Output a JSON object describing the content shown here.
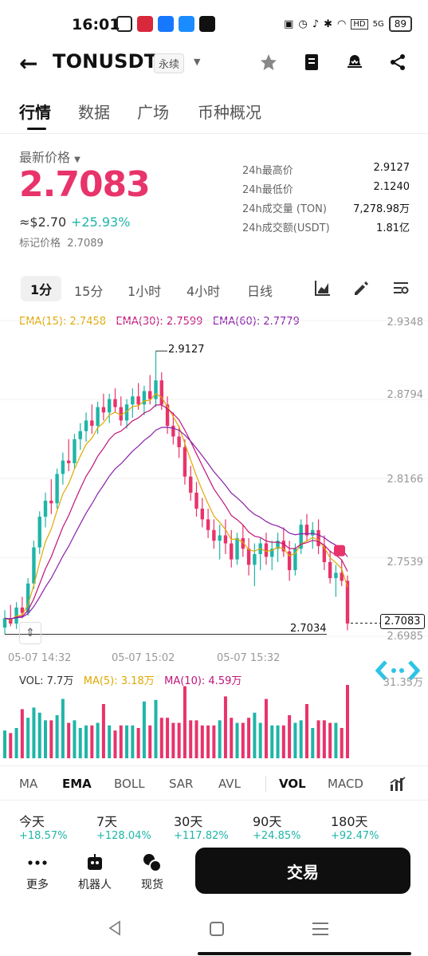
{
  "status_bar": {
    "time": "16:01",
    "network": "HD",
    "signal": "5G",
    "battery": "89"
  },
  "header": {
    "pair": "TONUSDT",
    "contract_type": "永续"
  },
  "tabs": [
    {
      "label": "行情",
      "active": true
    },
    {
      "label": "数据",
      "active": false
    },
    {
      "label": "广场",
      "active": false
    },
    {
      "label": "币种概况",
      "active": false
    }
  ],
  "price": {
    "label": "最新价格",
    "last": "2.7083",
    "usd_approx": "≈$2.70",
    "change_pct": "+25.93%",
    "mark_label": "标记价格",
    "mark_value": "2.7089"
  },
  "stats": [
    {
      "key": "24h最高价",
      "value": "2.9127"
    },
    {
      "key": "24h最低价",
      "value": "2.1240"
    },
    {
      "key": "24h成交量 (TON)",
      "value": "7,278.98万"
    },
    {
      "key": "24h成交额(USDT)",
      "value": "1.81亿"
    }
  ],
  "intervals": [
    {
      "label": "1分",
      "active": true
    },
    {
      "label": "15分",
      "active": false
    },
    {
      "label": "1小时",
      "active": false
    },
    {
      "label": "4小时",
      "active": false
    },
    {
      "label": "日线",
      "active": false
    }
  ],
  "ema": {
    "ema15": "EMA(15): 2.7458",
    "ema30": "EMA(30): 2.7599",
    "ema60": "EMA(60): 2.7779"
  },
  "chart_data": {
    "type": "candlestick",
    "y_ticks": [
      "2.9348",
      "2.8794",
      "2.8166",
      "2.7539",
      "2.6985"
    ],
    "x_ticks": [
      "05-07 14:32",
      "05-07 15:02",
      "05-07 15:32"
    ],
    "high_label": "2.9127",
    "low_label": "2.7034",
    "current_price": "2.7083",
    "ylim": [
      2.6985,
      2.9348
    ],
    "candles": [
      [
        2.705,
        2.718,
        2.7,
        2.712
      ],
      [
        2.712,
        2.722,
        2.706,
        2.708
      ],
      [
        2.708,
        2.724,
        2.704,
        2.72
      ],
      [
        2.72,
        2.728,
        2.712,
        2.716
      ],
      [
        2.716,
        2.742,
        2.714,
        2.738
      ],
      [
        2.738,
        2.77,
        2.734,
        2.765
      ],
      [
        2.765,
        2.792,
        2.76,
        2.788
      ],
      [
        2.788,
        2.806,
        2.78,
        2.8
      ],
      [
        2.8,
        2.816,
        2.79,
        2.798
      ],
      [
        2.798,
        2.824,
        2.794,
        2.82
      ],
      [
        2.82,
        2.836,
        2.812,
        2.83
      ],
      [
        2.83,
        2.846,
        2.822,
        2.828
      ],
      [
        2.828,
        2.85,
        2.824,
        2.846
      ],
      [
        2.846,
        2.858,
        2.838,
        2.852
      ],
      [
        2.852,
        2.866,
        2.844,
        2.86
      ],
      [
        2.86,
        2.872,
        2.85,
        2.856
      ],
      [
        2.856,
        2.874,
        2.85,
        2.87
      ],
      [
        2.87,
        2.88,
        2.86,
        2.866
      ],
      [
        2.866,
        2.88,
        2.858,
        2.876
      ],
      [
        2.876,
        2.884,
        2.866,
        2.87
      ],
      [
        2.87,
        2.878,
        2.856,
        2.86
      ],
      [
        2.86,
        2.876,
        2.854,
        2.872
      ],
      [
        2.872,
        2.884,
        2.862,
        2.878
      ],
      [
        2.878,
        2.888,
        2.868,
        2.872
      ],
      [
        2.872,
        2.886,
        2.864,
        2.882
      ],
      [
        2.882,
        2.894,
        2.872,
        2.876
      ],
      [
        2.876,
        2.912,
        2.87,
        2.89
      ],
      [
        2.89,
        2.896,
        2.868,
        2.872
      ],
      [
        2.872,
        2.878,
        2.85,
        2.856
      ],
      [
        2.856,
        2.866,
        2.842,
        2.848
      ],
      [
        2.848,
        2.856,
        2.832,
        2.84
      ],
      [
        2.84,
        2.846,
        2.812,
        2.818
      ],
      [
        2.818,
        2.826,
        2.8,
        2.806
      ],
      [
        2.806,
        2.814,
        2.788,
        2.794
      ],
      [
        2.794,
        2.802,
        2.78,
        2.786
      ],
      [
        2.786,
        2.794,
        2.772,
        2.778
      ],
      [
        2.778,
        2.786,
        2.764,
        2.77
      ],
      [
        2.77,
        2.782,
        2.756,
        2.774
      ],
      [
        2.774,
        2.786,
        2.76,
        2.768
      ],
      [
        2.768,
        2.778,
        2.75,
        2.756
      ],
      [
        2.756,
        2.776,
        2.752,
        2.772
      ],
      [
        2.772,
        2.782,
        2.758,
        2.764
      ],
      [
        2.764,
        2.772,
        2.744,
        2.752
      ],
      [
        2.752,
        2.768,
        2.736,
        2.76
      ],
      [
        2.76,
        2.772,
        2.748,
        2.768
      ],
      [
        2.768,
        2.776,
        2.752,
        2.758
      ],
      [
        2.758,
        2.77,
        2.748,
        2.764
      ],
      [
        2.764,
        2.776,
        2.754,
        2.77
      ],
      [
        2.77,
        2.78,
        2.758,
        2.762
      ],
      [
        2.762,
        2.77,
        2.74,
        2.748
      ],
      [
        2.748,
        2.768,
        2.744,
        2.764
      ],
      [
        2.764,
        2.786,
        2.76,
        2.782
      ],
      [
        2.782,
        2.79,
        2.77,
        2.774
      ],
      [
        2.774,
        2.784,
        2.764,
        2.778
      ],
      [
        2.778,
        2.786,
        2.76,
        2.766
      ],
      [
        2.766,
        2.774,
        2.748,
        2.754
      ],
      [
        2.754,
        2.762,
        2.738,
        2.742
      ],
      [
        2.742,
        2.752,
        2.728,
        2.746
      ],
      [
        2.746,
        2.756,
        2.736,
        2.74
      ],
      [
        2.74,
        2.744,
        2.703,
        2.708
      ]
    ]
  },
  "volume": {
    "vol": "VOL: 7.7万",
    "ma5": "MA(5): 3.18万",
    "ma10": "MA(10): 4.59万",
    "axis_max": "31.35万"
  },
  "indicators": [
    {
      "label": "MA",
      "active": false
    },
    {
      "label": "EMA",
      "active": true
    },
    {
      "label": "BOLL",
      "active": false
    },
    {
      "label": "SAR",
      "active": false
    },
    {
      "label": "AVL",
      "active": false
    },
    {
      "label": "VOL",
      "active": true
    },
    {
      "label": "MACD",
      "active": false
    }
  ],
  "returns": [
    {
      "label": "今天",
      "value": "+18.57%"
    },
    {
      "label": "7天",
      "value": "+128.04%"
    },
    {
      "label": "30天",
      "value": "+117.82%"
    },
    {
      "label": "90天",
      "value": "+24.85%"
    },
    {
      "label": "180天",
      "value": "+92.47%"
    }
  ],
  "bottom": {
    "more": "更多",
    "bot": "机器人",
    "spot": "现货",
    "trade": "交易"
  },
  "colors": {
    "up": "#1fb5a8",
    "down": "#e8336b",
    "ema15": "#e0a800",
    "ema30": "#c0147a",
    "ema60": "#8a1fa8"
  }
}
